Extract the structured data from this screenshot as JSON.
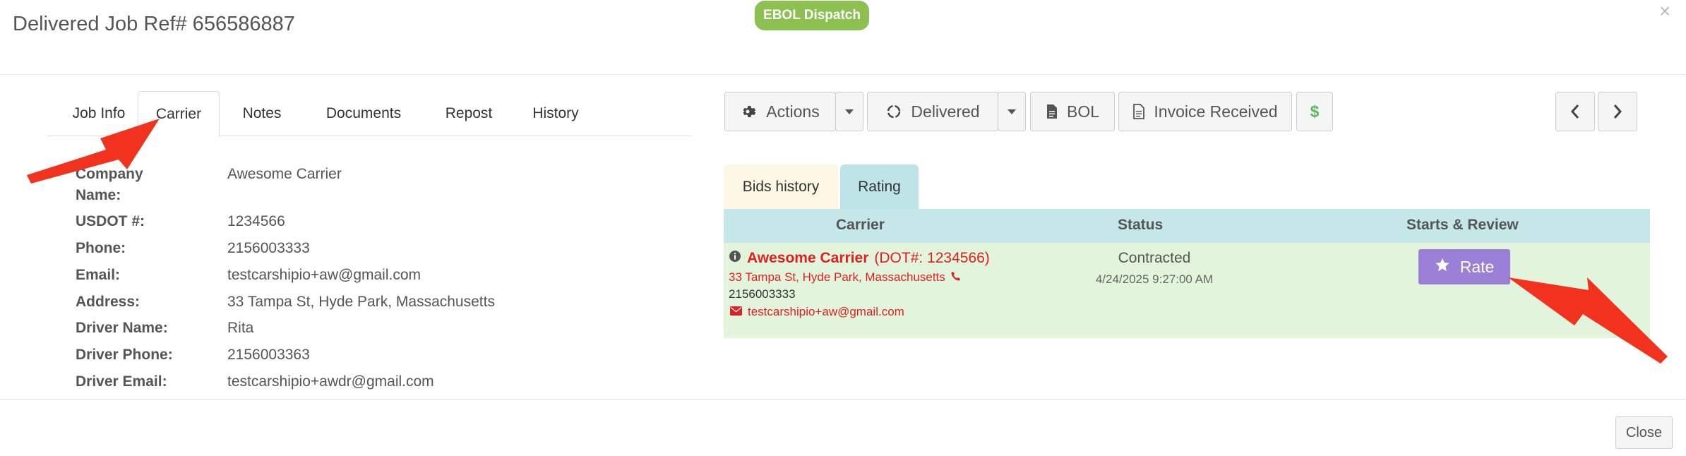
{
  "header": {
    "title": "Delivered Job Ref# 656586887",
    "badge": "EBOL Dispatch",
    "close_glyph": "×"
  },
  "left_tabs": [
    {
      "label": "Job Info"
    },
    {
      "label": "Carrier",
      "active": true
    },
    {
      "label": "Notes"
    },
    {
      "label": "Documents"
    },
    {
      "label": "Repost"
    },
    {
      "label": "History"
    }
  ],
  "carrier_fields": [
    {
      "label": "Company Name:",
      "value": "Awesome Carrier"
    },
    {
      "label": "USDOT #:",
      "value": "1234566"
    },
    {
      "label": "Phone:",
      "value": "2156003333"
    },
    {
      "label": "Email:",
      "value": "testcarshipio+aw@gmail.com"
    },
    {
      "label": "Address:",
      "value": "33 Tampa St, Hyde Park, Massachusetts"
    },
    {
      "label": "Driver Name:",
      "value": "Rita"
    },
    {
      "label": "Driver Phone:",
      "value": "2156003363"
    },
    {
      "label": "Driver Email:",
      "value": "testcarshipio+awdr@gmail.com"
    }
  ],
  "toolbar": {
    "actions_label": "Actions",
    "status_label": "Delivered",
    "bol_label": "BOL",
    "invoice_label": "Invoice Received",
    "dollar_label": "$"
  },
  "right_tabs": {
    "bids_label": "Bids history",
    "rating_label": "Rating"
  },
  "rating_table": {
    "headers": {
      "carrier": "Carrier",
      "status": "Status",
      "review": "Starts & Review"
    },
    "row": {
      "carrier_name": "Awesome Carrier",
      "dot": "(DOT#: 1234566)",
      "address": "33 Tampa St, Hyde Park, Massachusetts",
      "phone": "2156003333",
      "email": "testcarshipio+aw@gmail.com",
      "status": "Contracted",
      "status_time": "4/24/2025 9:27:00 AM",
      "rate_label": "Rate"
    }
  },
  "footer": {
    "close_label": "Close"
  },
  "colors": {
    "accent_green": "#8cc152",
    "rate_purple": "#9c7fd6",
    "carrier_red": "#e02020",
    "annotation_arrow": "#f0321e"
  }
}
